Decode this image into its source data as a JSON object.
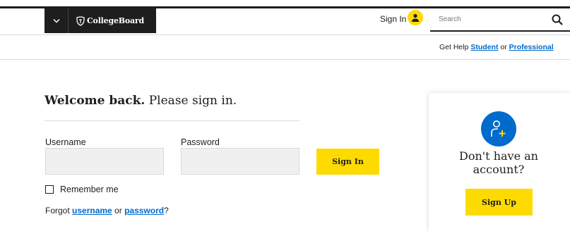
{
  "header": {
    "brand": "CollegeBoard",
    "sign_in": "Sign In",
    "search_placeholder": "Search"
  },
  "help": {
    "prefix": "Get Help",
    "student": "Student",
    "or": "or",
    "professional": "Professional"
  },
  "login": {
    "welcome_bold": "Welcome back.",
    "welcome_rest": " Please sign in.",
    "username_label": "Username",
    "password_label": "Password",
    "sign_in_button": "Sign In",
    "remember_label": "Remember me",
    "forgot_prefix": "Forgot ",
    "forgot_username": "username",
    "forgot_or": " or ",
    "forgot_password": "password",
    "forgot_suffix": "?"
  },
  "signup_card": {
    "line1": "Don't have an",
    "line2": "account?",
    "button": "Sign Up"
  },
  "colors": {
    "accent_yellow": "#fedb00",
    "link_blue": "#006acd",
    "dark": "#1e1e1e"
  },
  "icons": {
    "menu": "chevron-down-icon",
    "logo": "acorn-logo-icon",
    "user": "user-icon",
    "search": "search-icon",
    "add_user": "add-user-icon"
  }
}
